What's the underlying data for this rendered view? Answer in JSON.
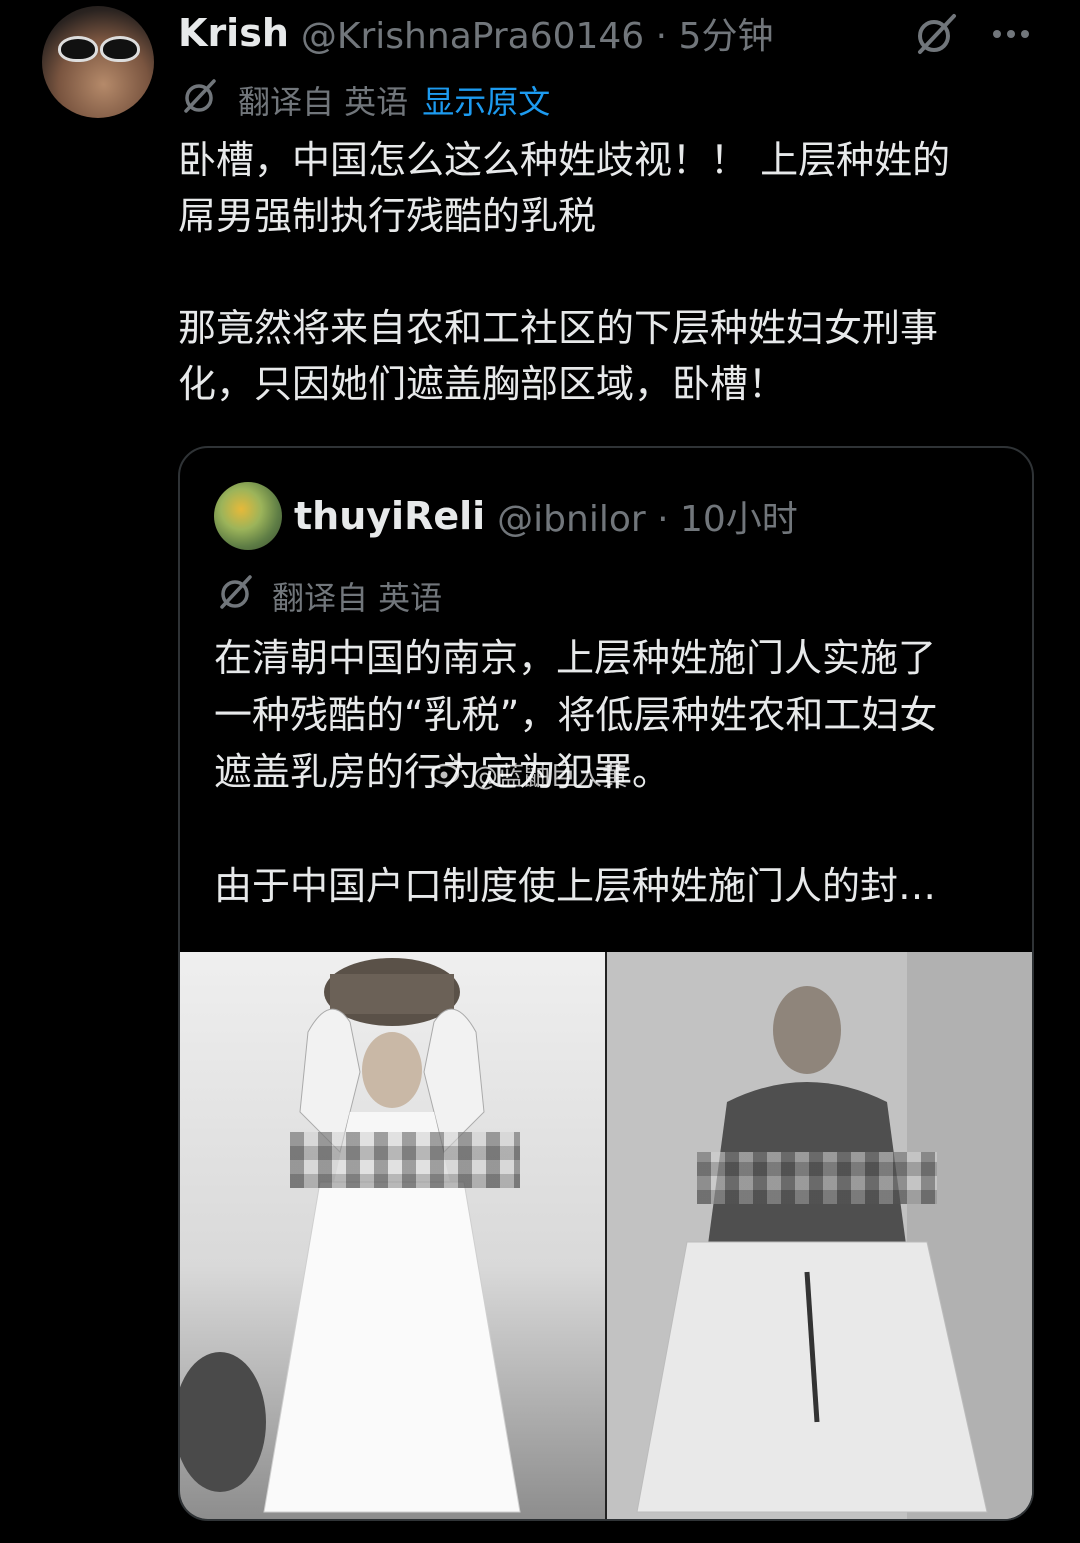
{
  "tweet": {
    "author_name": "Krish",
    "author_handle": "@KrishnaPra60146 · 5分钟",
    "translated_from": "翻译自 英语",
    "show_original": "显示原文",
    "text": "卧槽，中国怎么这么种姓歧视！！ 上层种姓的\n屌男强制执行残酷的乳税\n\n那竟然将来自农和工社区的下层种姓妇女刑事\n化，只因她们遮盖胸部区域，卧槽！"
  },
  "quoted": {
    "author_name": "thuyiReli",
    "author_handle": "@ibnilor · 10小时",
    "translated_from": "翻译自 英语",
    "text": "在清朝中国的南京，上层种姓施门人实施了\n一种残酷的“乳税”，将低层种姓农和工妇女\n遮盖乳房的行为定为犯罪。\n\n由于中国户口制度使上层种姓施门人的封…"
  },
  "watermark": "@蓝鼬巨人黄",
  "icons": {
    "translate": "translate-icon",
    "grok": "grok-icon",
    "more": "more-icon",
    "weibo": "weibo-icon"
  },
  "colors": {
    "background": "#000000",
    "text": "#e7e9ea",
    "muted": "#71767b",
    "link": "#1d9bf0",
    "border": "#2f3336"
  }
}
